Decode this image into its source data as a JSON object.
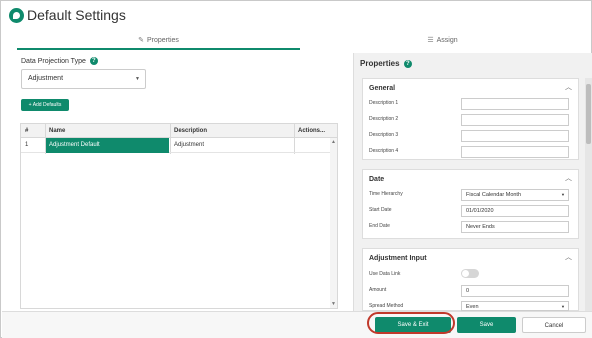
{
  "window": {
    "title": "Default Settings",
    "logo_icon": "leaf-logo-icon"
  },
  "tabs": [
    {
      "label": "Properties",
      "icon": "pencil-icon",
      "active": true
    },
    {
      "label": "Assign",
      "icon": "list-icon",
      "active": false
    }
  ],
  "left": {
    "projection_type_label": "Data Projection Type",
    "projection_type_value": "Adjustment",
    "add_defaults_label": "+ Add Defaults",
    "grid": {
      "columns": [
        "#",
        "Name",
        "Description",
        "Actions..."
      ],
      "rows": [
        {
          "num": "1",
          "name": "Adjustment Default",
          "description": "Adjustment"
        }
      ]
    }
  },
  "properties": {
    "title": "Properties",
    "general": {
      "title": "General",
      "fields": [
        "Description 1",
        "Description 2",
        "Description 3",
        "Description 4"
      ]
    },
    "date": {
      "title": "Date",
      "time_hierarchy_label": "Time Hierarchy",
      "time_hierarchy_value": "Fiscal Calendar Month",
      "start_date_label": "Start Date",
      "start_date_value": "01/01/2020",
      "end_date_label": "End Date",
      "end_date_value": "Never Ends"
    },
    "adjustment_input": {
      "title": "Adjustment Input",
      "use_data_link_label": "Use Data Link",
      "amount_label": "Amount",
      "amount_value": "0",
      "spread_method_label": "Spread Method",
      "spread_method_value": "Even"
    }
  },
  "footer": {
    "save_exit": "Save & Exit",
    "save": "Save",
    "cancel": "Cancel"
  },
  "colors": {
    "accent": "#0f8a6c",
    "highlight": "#c0392b"
  }
}
